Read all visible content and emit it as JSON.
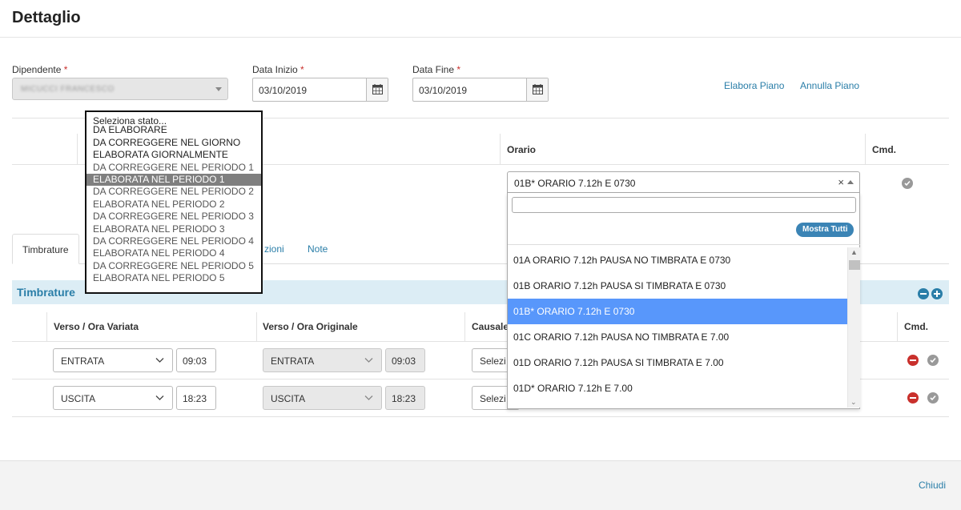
{
  "page": {
    "title": "Dettaglio",
    "close_label": "Chiudi"
  },
  "form": {
    "dipendente_label": "Dipendente",
    "dipendente_value": "MICUCCI FRANCESCO",
    "data_inizio_label": "Data Inizio",
    "data_inizio_value": "03/10/2019",
    "data_fine_label": "Data Fine",
    "data_fine_value": "03/10/2019",
    "required_mark": "*",
    "elabora_label": "Elabora Piano",
    "annulla_label": "Annulla Piano"
  },
  "grid": {
    "orario_header": "Orario",
    "cmd_header": "Cmd."
  },
  "orario": {
    "selected": "01B* ORARIO 7.12h E 0730",
    "clear": "×",
    "search_value": "",
    "show_all_label": "Mostra Tutti",
    "options": [
      "01A ORARIO 7.12h PAUSA NO TIMBRATA E 0730",
      "01B ORARIO 7.12h PAUSA SI TIMBRATA E 0730",
      "01B* ORARIO 7.12h E 0730",
      "01C ORARIO 7.12h PAUSA NO TIMBRATA E 7.00",
      "01D ORARIO 7.12h PAUSA SI TIMBRATA E 7.00",
      "01D* ORARIO 7.12h E 7.00"
    ],
    "selected_index": 2
  },
  "stato": {
    "options": [
      "Seleziona stato...",
      "DA ELABORARE",
      "DA CORREGGERE NEL GIORNO",
      "ELABORATA GIORNALMENTE",
      "DA CORREGGERE NEL PERIODO 1",
      "ELABORATA NEL PERIODO 1",
      "DA CORREGGERE NEL PERIODO 2",
      "ELABORATA NEL PERIODO 2",
      "DA CORREGGERE NEL PERIODO 3",
      "ELABORATA NEL PERIODO 3",
      "DA CORREGGERE NEL PERIODO 4",
      "ELABORATA NEL PERIODO 4",
      "DA CORREGGERE NEL PERIODO 5",
      "ELABORATA NEL PERIODO 5"
    ],
    "highlighted_index": 5
  },
  "tabs": {
    "timbrature": "Timbrature",
    "partial": "zioni",
    "note": "Note"
  },
  "timbrature": {
    "section_title": "Timbrature",
    "headers": {
      "verso_variata": "Verso / Ora Variata",
      "verso_originale": "Verso / Ora Originale",
      "causale": "Causale",
      "cmd": "Cmd."
    },
    "rows": [
      {
        "verso": "ENTRATA",
        "ora": "09:03",
        "verso_orig": "ENTRATA",
        "ora_orig": "09:03",
        "causale": "Selezi"
      },
      {
        "verso": "USCITA",
        "ora": "18:23",
        "verso_orig": "USCITA",
        "ora_orig": "18:23",
        "causale": "Selezi"
      }
    ]
  }
}
